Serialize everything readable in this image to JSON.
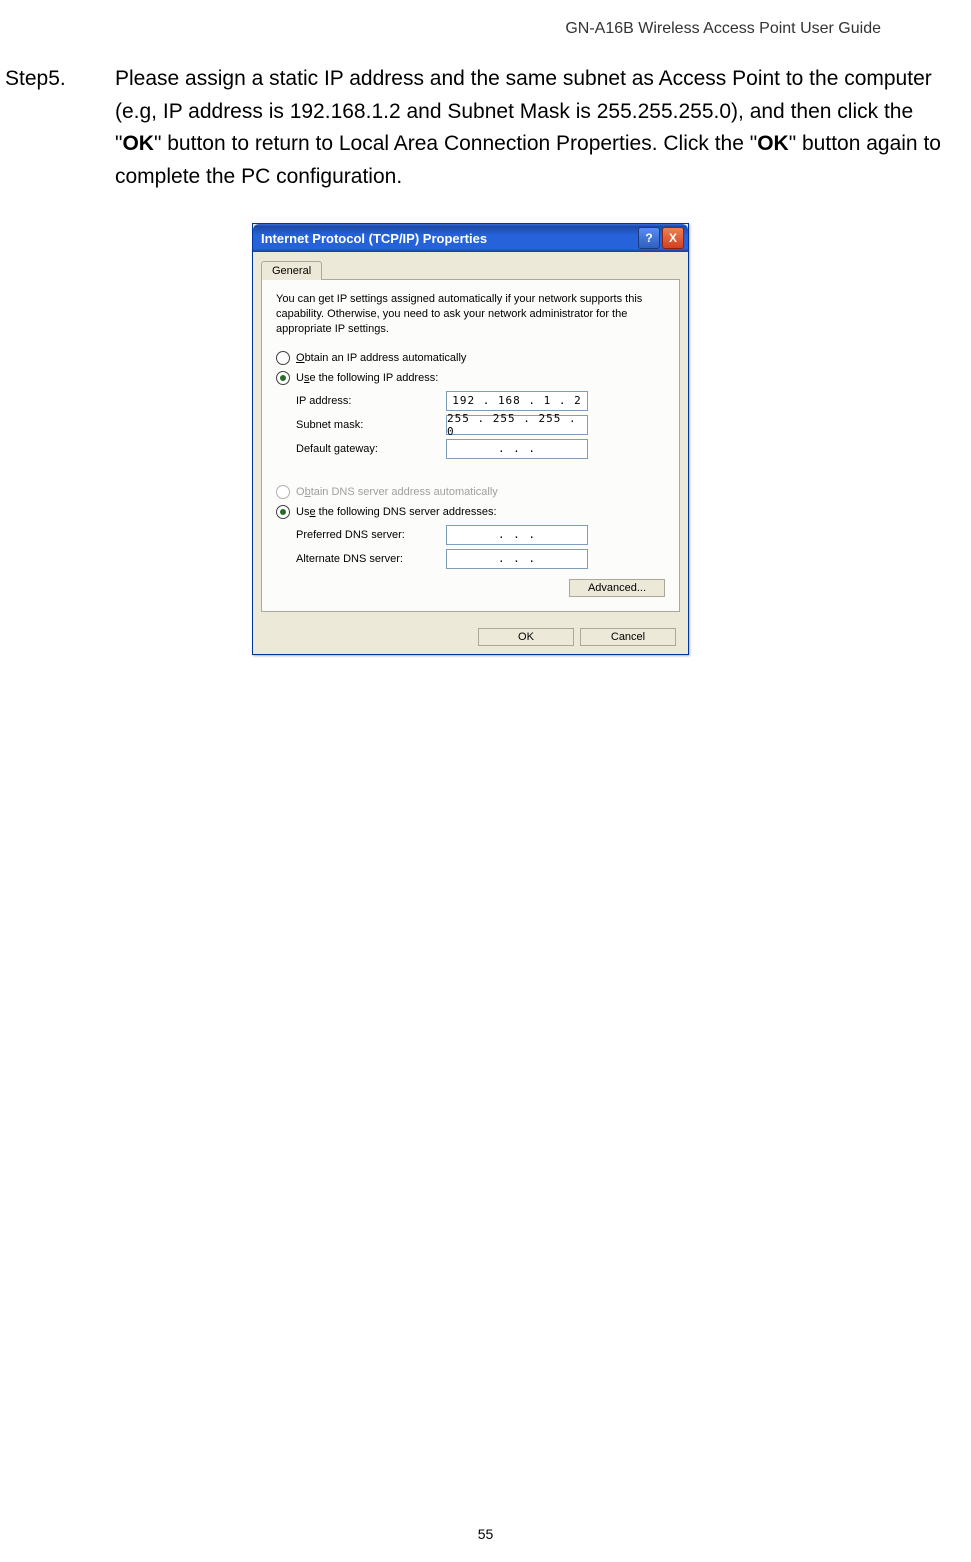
{
  "header": "GN-A16B Wireless Access Point User Guide",
  "step": {
    "label": "Step5.",
    "text_parts": [
      "Please assign a static IP address and the same subnet as Access Point to the computer (e.g, IP address is 192.168.1.2 and Subnet Mask is 255.255.255.0), and then click the \"",
      "OK",
      "\" button to return to Local Area Connection Properties. Click the \"",
      "OK",
      "\" button again to complete the PC configuration."
    ]
  },
  "dialog": {
    "title": "Internet Protocol (TCP/IP) Properties",
    "help": "?",
    "close": "X",
    "tab": "General",
    "desc": "You can get IP settings assigned automatically if your network supports this capability. Otherwise, you need to ask your network administrator for the appropriate IP settings.",
    "radio_auto_ip": "Obtain an IP address automatically",
    "radio_use_ip": "Use the following IP address:",
    "ip_label": "IP address:",
    "ip_value": "192 . 168 .  1  .  2",
    "subnet_label": "Subnet mask:",
    "subnet_value": "255 . 255 . 255 .  0",
    "gateway_label": "Default gateway:",
    "gateway_value": ".        .        .",
    "radio_auto_dns": "Obtain DNS server address automatically",
    "radio_use_dns": "Use the following DNS server addresses:",
    "pref_dns_label": "Preferred DNS server:",
    "pref_dns_value": ".        .        .",
    "alt_dns_label": "Alternate DNS server:",
    "alt_dns_value": ".        .        .",
    "advanced": "Advanced...",
    "ok": "OK",
    "cancel": "Cancel"
  },
  "page_number": "55"
}
